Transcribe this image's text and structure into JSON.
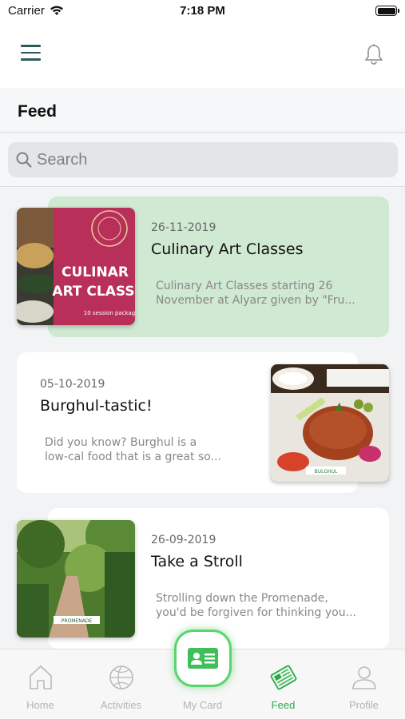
{
  "status_bar": {
    "carrier": "Carrier",
    "time": "7:18 PM"
  },
  "header": {
    "menu_icon": "hamburger-menu-icon",
    "notification_icon": "bell-icon"
  },
  "feed": {
    "title": "Feed",
    "search_placeholder": "Search"
  },
  "posts": [
    {
      "date": "26-11-2019",
      "title": "Culinary Art Classes",
      "description": "Culinary Art Classes starting 26\nNovember at Alyarz given by \"Fru...",
      "highlighted": true,
      "highlight_color": "#cfe9d2",
      "image_overlay_line1": "CULINAR",
      "image_overlay_line2": "ART CLASS",
      "image_caption": "10 session packag"
    },
    {
      "date": "05-10-2019",
      "title": "Burghul-tastic!",
      "description": "Did you know? Burghul is a\nlow-cal food that is a great so...",
      "highlighted": false,
      "image_caption": "BULGHUL"
    },
    {
      "date": "26-09-2019",
      "title": "Take a Stroll",
      "description": "Strolling down the Promenade,\nyou'd be forgiven for thinking you...",
      "highlighted": false,
      "image_caption": "PROMENADE"
    }
  ],
  "tab_bar": {
    "accent_color": "#2ea84a",
    "active_tab": "Feed",
    "tabs": [
      {
        "label": "Home",
        "icon": "home-icon"
      },
      {
        "label": "Activities",
        "icon": "basketball-icon"
      },
      {
        "label": "My Card",
        "icon": "id-card-icon"
      },
      {
        "label": "Feed",
        "icon": "newspaper-icon"
      },
      {
        "label": "Profile",
        "icon": "person-icon"
      }
    ]
  }
}
